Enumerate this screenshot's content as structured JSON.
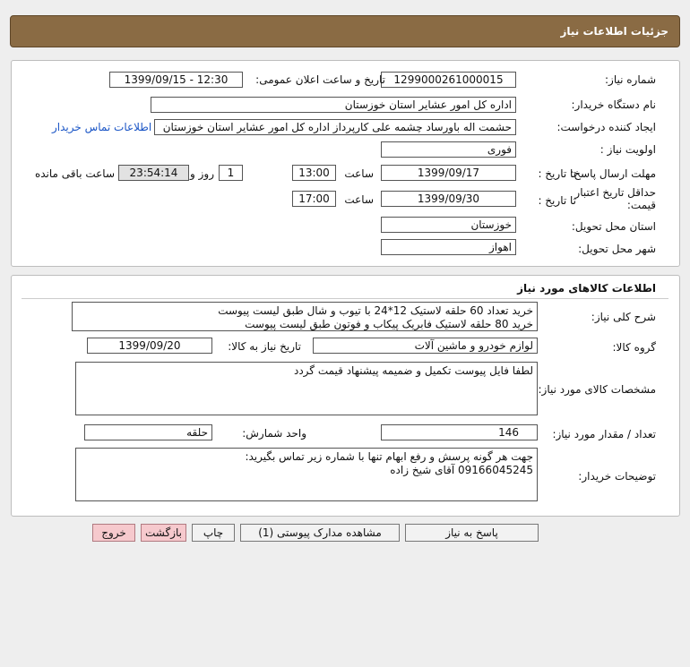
{
  "header": {
    "title": "جزئیات اطلاعات نیاز"
  },
  "info": {
    "need_number_label": "شماره نیاز:",
    "need_number": "1299000261000015",
    "announce_label": "تاریخ و ساعت اعلان عمومی:",
    "announce_value": "1399/09/15 - 12:30",
    "buyer_org_label": "نام دستگاه خریدار:",
    "buyer_org": "اداره کل امور عشایر استان خوزستان",
    "requester_label": "ایجاد کننده درخواست:",
    "requester": "حشمت اله باورساد چشمه علی کارپرداز اداره کل امور عشایر استان خوزستان",
    "contact_link": "اطلاعات تماس خریدار",
    "priority_label": "اولویت نیاز :",
    "priority": "فوری",
    "deadline_label": "مهلت ارسال پاسخ:",
    "to_date_label": "تا تاریخ :",
    "deadline_date": "1399/09/17",
    "time_label": "ساعت",
    "deadline_time": "13:00",
    "days_value": "1",
    "days_label": "روز و",
    "remaining_time": "23:54:14",
    "remaining_label": "ساعت باقی مانده",
    "validity_label": "حداقل تاریخ اعتبار قیمت:",
    "validity_date": "1399/09/30",
    "validity_time": "17:00",
    "province_label": "استان محل تحویل:",
    "province": "خوزستان",
    "city_label": "شهر محل تحویل:",
    "city": "اهواز"
  },
  "goods": {
    "title": "اطلاعات کالاهای مورد نیاز",
    "desc_label": "شرح کلی نیاز:",
    "desc_line1": "خرید تعداد 60 حلقه لاستیک 12*24 با تیوب و شال طبق لیست پیوست",
    "desc_line2": "خرید 80 حلقه لاستیک فابریک پیکاب و فوتون طبق لیست پیوست",
    "group_label": "گروه کالا:",
    "group": "لوازم خودرو و ماشین آلات",
    "need_date_label": "تاریخ نیاز به کالا:",
    "need_date": "1399/09/20",
    "specs_label": "مشخصات کالای مورد نیاز:",
    "specs": "لطفا فایل پیوست تکمیل و ضمیمه پیشنهاد قیمت گردد",
    "qty_label": "تعداد / مقدار مورد نیاز:",
    "qty": "146",
    "unit_label": "واحد شمارش:",
    "unit": "حلقه",
    "buyer_notes_label": "توضیحات خریدار:",
    "notes_line1": "جهت هر گونه پرسش و رفع ابهام تنها با شماره زیر تماس بگیرید:",
    "notes_line2": "09166045245 آقای شیخ زاده"
  },
  "buttons": {
    "reply": "پاسخ به نیاز",
    "attachments": "مشاهده مدارک پیوستی (1)",
    "print": "چاپ",
    "back": "بازگشت",
    "exit": "خروج"
  }
}
